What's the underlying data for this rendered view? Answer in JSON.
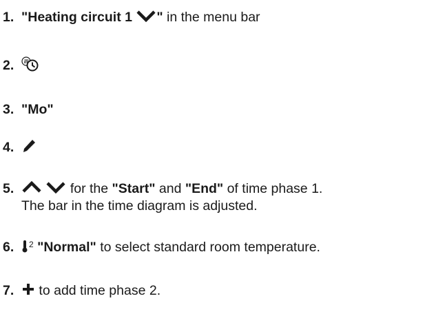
{
  "steps": [
    {
      "number": "1.",
      "bold_text": "\"Heating circuit 1 ",
      "icon": "chevron-down-icon",
      "bold_close": "\"",
      "text": " in the menu bar"
    },
    {
      "number": "2.",
      "icon": "heating-time-program-icon"
    },
    {
      "number": "3.",
      "bold_text": "\"Mo\""
    },
    {
      "number": "4.",
      "icon": "pencil-icon"
    },
    {
      "number": "5.",
      "icons": [
        "chevron-up-icon",
        "chevron-down-icon"
      ],
      "text_before_start": " for the ",
      "start_label": "\"Start\"",
      "text_and": " and ",
      "end_label": "\"End\"",
      "text_after": " of time phase 1.",
      "second_line": "The bar in the time diagram is adjusted."
    },
    {
      "number": "6.",
      "icon": "thermometer-level-icon",
      "icon_superscript": "2",
      "bold_text": "\"Normal\"",
      "text": " to select standard room temperature."
    },
    {
      "number": "7.",
      "icon": "plus-icon",
      "text": " to add time phase 2."
    }
  ]
}
